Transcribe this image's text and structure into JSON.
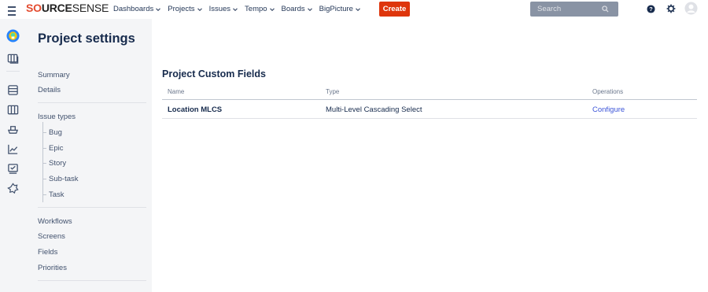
{
  "topbar": {
    "logo": {
      "brand_red": "SO",
      "brand_bold": "URCE",
      "brand_thin": "SENSE"
    },
    "nav": [
      {
        "label": "Dashboards"
      },
      {
        "label": "Projects"
      },
      {
        "label": "Issues"
      },
      {
        "label": "Tempo"
      },
      {
        "label": "Boards"
      },
      {
        "label": "BigPicture"
      }
    ],
    "create_label": "Create",
    "search_placeholder": "Search",
    "colors": {
      "create": "#de350b",
      "search": "#8993a4",
      "brand_red": "#e34b2f"
    }
  },
  "project_sidebar": {
    "title": "Project settings",
    "items_top": [
      "Summary",
      "Details"
    ],
    "issue_types_label": "Issue types",
    "issue_types": [
      "Bug",
      "Epic",
      "Story",
      "Sub-task",
      "Task"
    ],
    "items_bottom": [
      "Workflows",
      "Screens",
      "Fields",
      "Priorities"
    ]
  },
  "main": {
    "section_title": "Project Custom Fields",
    "columns": [
      "Name",
      "Type",
      "Operations"
    ],
    "rows": [
      {
        "name": "Location MLCS",
        "type": "Multi-Level Cascading Select",
        "operation": "Configure"
      }
    ],
    "link_color": "#3c55d8"
  },
  "left_rail_icons": [
    "project-avatar-icon",
    "board-icon",
    "backlog-icon",
    "columns-icon",
    "releases-icon",
    "reports-icon",
    "issues-icon",
    "components-icon"
  ]
}
